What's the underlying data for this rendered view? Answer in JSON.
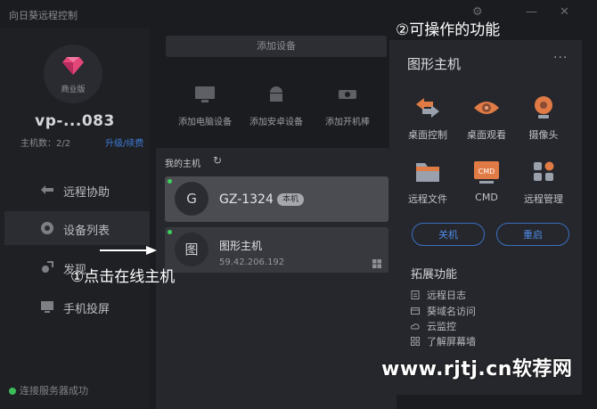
{
  "app": {
    "title": "向日葵远程控制"
  },
  "window": {
    "settings_glyph": "⚙",
    "min_glyph": "—",
    "close_glyph": "✕"
  },
  "sidebar": {
    "vip_label": "商业版",
    "username": "vp-...083",
    "host_count": "主机数：2/2",
    "upgrade_link": "升级/续费",
    "nav_items": [
      {
        "label": "远程协助",
        "icon": "remote-assist-icon"
      },
      {
        "label": "设备列表",
        "icon": "device-list-icon"
      },
      {
        "label": "发现",
        "icon": "discover-icon"
      },
      {
        "label": "手机投屏",
        "icon": "screen-cast-icon"
      }
    ],
    "status": "连接服务器成功"
  },
  "toolbar": {
    "add_device": "添加设备"
  },
  "quick_actions": [
    {
      "label": "添加电脑设备",
      "icon": "monitor-icon"
    },
    {
      "label": "添加安卓设备",
      "icon": "android-icon"
    },
    {
      "label": "添加开机棒",
      "icon": "boot-stick-icon"
    }
  ],
  "hosts": {
    "title": "我的主机",
    "refresh_glyph": "↻",
    "items": [
      {
        "avatar": "G",
        "name": "GZ-1324",
        "badge": "本机"
      },
      {
        "avatar": "图",
        "name": "图形主机",
        "ip": "59.42.206.192"
      }
    ]
  },
  "annotations": {
    "step1": "①点击在线主机",
    "step2": "②可操作的功能"
  },
  "panel": {
    "title": "图形主机",
    "more": "···",
    "functions": [
      {
        "label": "桌面控制",
        "icon": "desktop-control-icon"
      },
      {
        "label": "桌面观看",
        "icon": "eye-icon"
      },
      {
        "label": "摄像头",
        "icon": "camera-icon"
      },
      {
        "label": "远程文件",
        "icon": "folder-icon"
      },
      {
        "label": "CMD",
        "icon": "cmd-icon"
      },
      {
        "label": "远程管理",
        "icon": "manage-icon"
      }
    ],
    "shutdown": "关机",
    "restart": "重启",
    "extension_title": "拓展功能",
    "extensions": [
      {
        "label": "远程日志",
        "icon": "log-icon"
      },
      {
        "label": "葵域名访问",
        "icon": "domain-icon"
      },
      {
        "label": "云监控",
        "icon": "cloud-icon"
      },
      {
        "label": "了解屏幕墙",
        "icon": "grid-icon"
      }
    ],
    "cmd_icon_text": "CMD"
  },
  "watermark": "www.rjtj.cn软荐网",
  "colors": {
    "accent": "#3c7bd6",
    "online": "#3fd15c",
    "orange": "#e07b45"
  }
}
